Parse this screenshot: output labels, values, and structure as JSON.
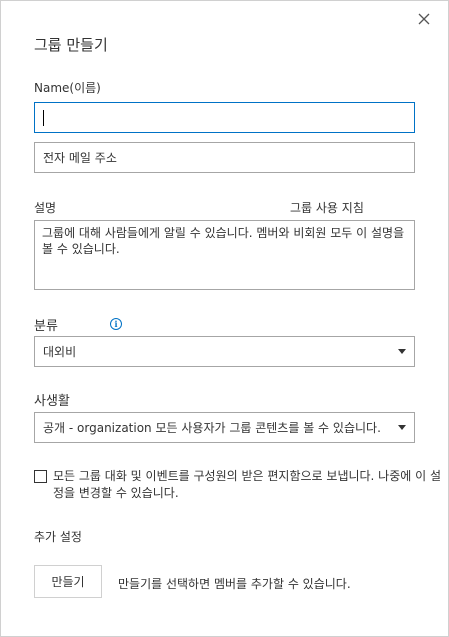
{
  "dialog": {
    "title": "그룹 만들기"
  },
  "form": {
    "name_label": "Name(이름)",
    "name_value": "",
    "email_placeholder": "전자 메일 주소",
    "description_label": "설명",
    "guidelines_link": "그룹 사용 지침",
    "description_value": "그룹에 대해 사람들에게 알릴 수 있습니다. 멤버와 비회원 모두 이 설명을 볼 수 있습니다.",
    "classification_label": "분류",
    "classification_value": "대외비",
    "privacy_label": "사생활",
    "privacy_value": "공개 - organization 모든 사용자가 그룹 콘텐츠를 볼 수 있습니다.",
    "subscribe_checked": false,
    "subscribe_text": "모든 그룹 대화 및 이벤트를 구성원의 받은 편지함으로 보냅니다. 나중에 이 설정을 변경할 수 있습니다.",
    "additional_settings": "추가 설정",
    "create_button": "만들기",
    "create_hint": "만들기를 선택하면 멤버를 추가할 수 있습니다."
  },
  "icons": {
    "close": "close-icon",
    "info": "info-icon",
    "dropdown": "chevron-down-icon"
  },
  "colors": {
    "focus_border": "#0072c6",
    "info": "#0072c6",
    "text": "#333333",
    "border": "#a6a6a6"
  }
}
